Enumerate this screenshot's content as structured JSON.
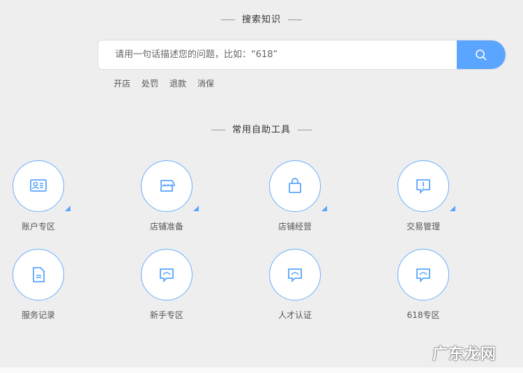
{
  "search_section": {
    "title": "搜索知识",
    "placeholder": "请用一句话描述您的问题，比如：“618”",
    "search_icon": "search-icon",
    "tags": [
      "开店",
      "处罚",
      "退款",
      "消保"
    ]
  },
  "tools_section": {
    "title": "常用自助工具",
    "items": [
      {
        "label": "账户专区",
        "icon": "id-card-icon",
        "expandable": true
      },
      {
        "label": "店铺准备",
        "icon": "store-icon",
        "expandable": true
      },
      {
        "label": "店铺经营",
        "icon": "shopping-bag-icon",
        "expandable": true
      },
      {
        "label": "交易管理",
        "icon": "alert-message-icon",
        "expandable": true
      },
      {
        "label": "服务记录",
        "icon": "document-icon",
        "expandable": false
      },
      {
        "label": "新手专区",
        "icon": "chat-icon",
        "expandable": false
      },
      {
        "label": "人才认证",
        "icon": "chat-icon",
        "expandable": false
      },
      {
        "label": "618专区",
        "icon": "chat-icon",
        "expandable": false
      }
    ]
  },
  "watermark": "广东龙网",
  "colors": {
    "accent": "#5aa5ff",
    "background": "#eeeeee"
  }
}
